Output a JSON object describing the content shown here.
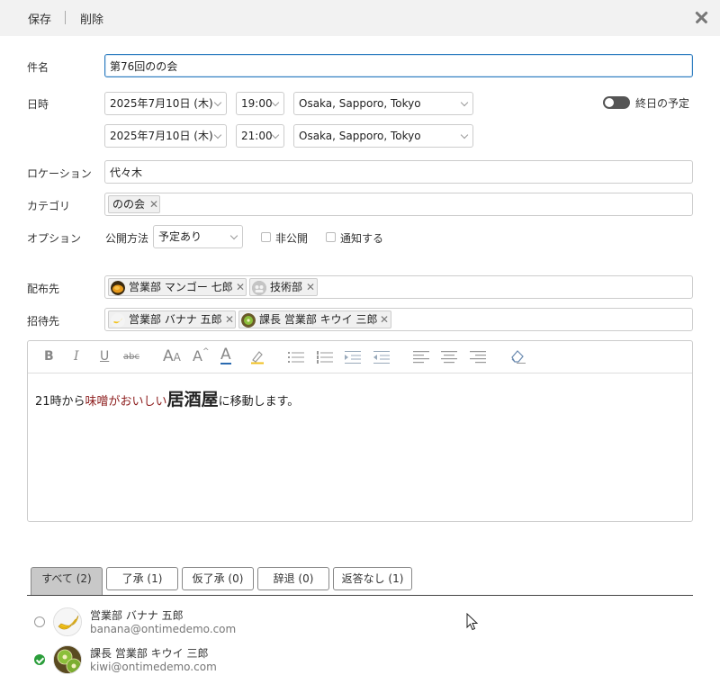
{
  "toolbar": {
    "save": "保存",
    "delete": "削除"
  },
  "form": {
    "subject": {
      "label": "件名",
      "value": "第76回のの会"
    },
    "datetime": {
      "label": "日時",
      "start_date": "2025年7月10日 (木)",
      "start_time": "19:00",
      "start_tz": "Osaka, Sapporo, Tokyo",
      "end_date": "2025年7月10日 (木)",
      "end_time": "21:00",
      "end_tz": "Osaka, Sapporo, Tokyo",
      "allday_label": "終日の予定"
    },
    "location": {
      "label": "ロケーション",
      "value": "代々木"
    },
    "category": {
      "label": "カテゴリ",
      "tags": [
        "のの会"
      ]
    },
    "options": {
      "label": "オプション",
      "visibility_label": "公開方法",
      "visibility_value": "予定あり",
      "private_label": "非公開",
      "notify_label": "通知する"
    },
    "distribution": {
      "label": "配布先",
      "tags": [
        "営業部 マンゴー 七郎",
        "技術部"
      ]
    },
    "invitees": {
      "label": "招待先",
      "tags": [
        "営業部 バナナ 五郎",
        "課長 営業部 キウイ 三郎"
      ]
    }
  },
  "editor": {
    "toolbar_icons": [
      "bold-icon",
      "italic-icon",
      "underline-icon",
      "strikethrough-icon",
      "font-family-icon",
      "font-size-icon",
      "font-color-icon",
      "highlight-icon",
      "bullet-list-icon",
      "numbered-list-icon",
      "indent-icon",
      "outdent-icon",
      "align-left-icon",
      "align-center-icon",
      "align-right-icon",
      "clear-format-icon"
    ],
    "content": {
      "part1": "21時から",
      "part2": "味噌がおいしい",
      "part3": "居酒屋",
      "part4": "に移動します。"
    },
    "colors": {
      "highlight_text": "#8b1a1a"
    }
  },
  "responses": {
    "tabs": [
      {
        "label": "すべて (2)",
        "active": true
      },
      {
        "label": "了承 (1)",
        "active": false
      },
      {
        "label": "仮了承 (0)",
        "active": false
      },
      {
        "label": "辞退 (0)",
        "active": false
      },
      {
        "label": "返答なし (1)",
        "active": false
      }
    ],
    "attendees": [
      {
        "name": "営業部 バナナ 五郎",
        "email": "banana@ontimedemo.com",
        "status": "no-response"
      },
      {
        "name": "課長 営業部 キウイ 三郎",
        "email": "kiwi@ontimedemo.com",
        "status": "accepted"
      }
    ]
  }
}
